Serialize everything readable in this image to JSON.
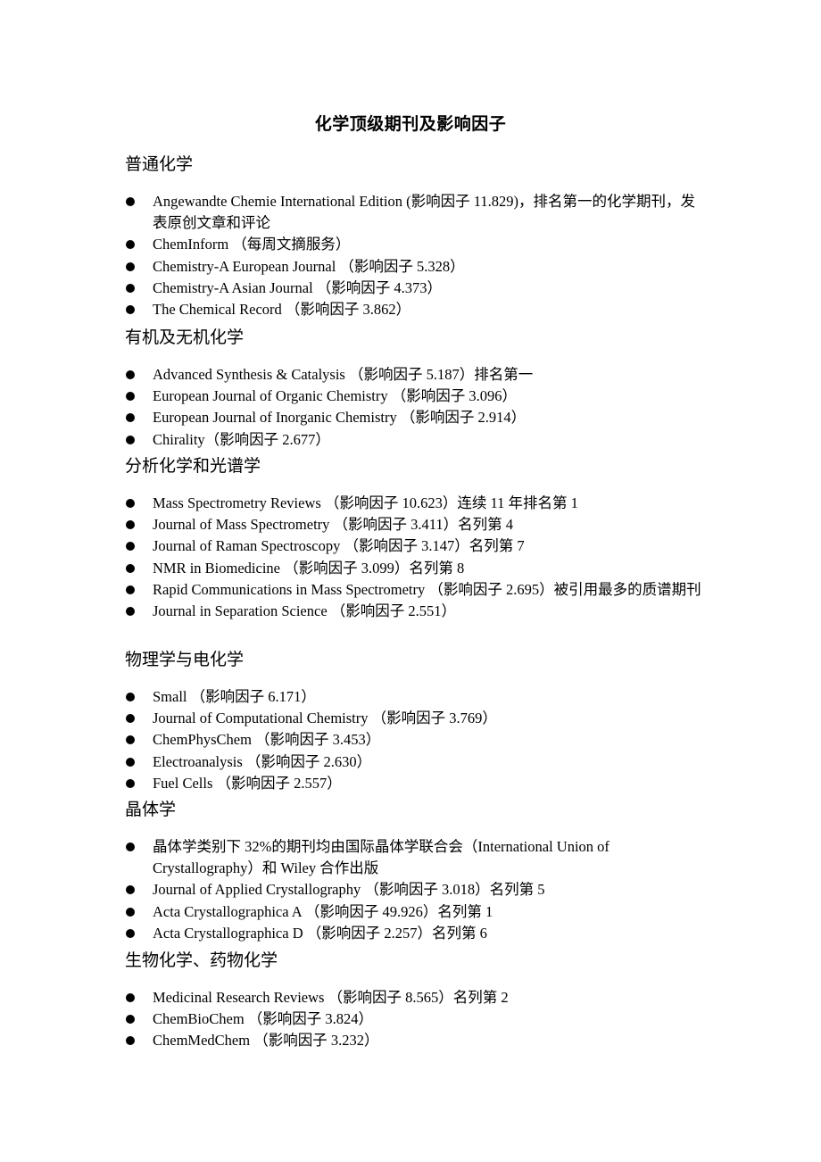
{
  "title": "化学顶级期刊及影响因子",
  "sections": [
    {
      "heading": "普通化学",
      "items": [
        "Angewandte Chemie International Edition (影响因子 11.829)，排名第一的化学期刊，发表原创文章和评论",
        "ChemInform （每周文摘服务）",
        "Chemistry-A European Journal （影响因子 5.328）",
        "Chemistry-A Asian Journal （影响因子 4.373）",
        "The Chemical Record （影响因子 3.862）"
      ]
    },
    {
      "heading": "有机及无机化学",
      "items": [
        "Advanced Synthesis & Catalysis （影响因子 5.187）排名第一",
        "European Journal of Organic Chemistry （影响因子 3.096）",
        "European Journal of Inorganic Chemistry （影响因子 2.914）",
        "Chirality（影响因子 2.677）"
      ]
    },
    {
      "heading": "分析化学和光谱学",
      "items": [
        "Mass Spectrometry Reviews （影响因子 10.623）连续 11 年排名第 1",
        "Journal of Mass Spectrometry （影响因子 3.411）名列第 4",
        "Journal of Raman Spectroscopy （影响因子 3.147）名列第 7",
        "NMR in Biomedicine （影响因子 3.099）名列第 8",
        "Rapid Communications in Mass Spectrometry （影响因子 2.695）被引用最多的质谱期刊",
        "Journal in Separation Science （影响因子 2.551）"
      ]
    },
    {
      "heading": "物理学与电化学",
      "items": [
        "Small （影响因子 6.171）",
        "Journal of Computational Chemistry （影响因子 3.769）",
        "ChemPhysChem （影响因子 3.453）",
        "Electroanalysis （影响因子 2.630）",
        "Fuel Cells （影响因子 2.557）"
      ]
    },
    {
      "heading": "晶体学",
      "items": [
        "晶体学类别下 32%的期刊均由国际晶体学联合会（International Union of Crystallography）和 Wiley 合作出版",
        "Journal of Applied Crystallography （影响因子 3.018）名列第 5",
        "Acta Crystallographica A （影响因子 49.926）名列第 1",
        "Acta Crystallographica D （影响因子 2.257）名列第 6"
      ]
    },
    {
      "heading": "生物化学、药物化学",
      "items": [
        "Medicinal Research Reviews （影响因子 8.565）名列第 2",
        "ChemBioChem （影响因子 3.824）",
        "ChemMedChem （影响因子 3.232）"
      ]
    }
  ]
}
